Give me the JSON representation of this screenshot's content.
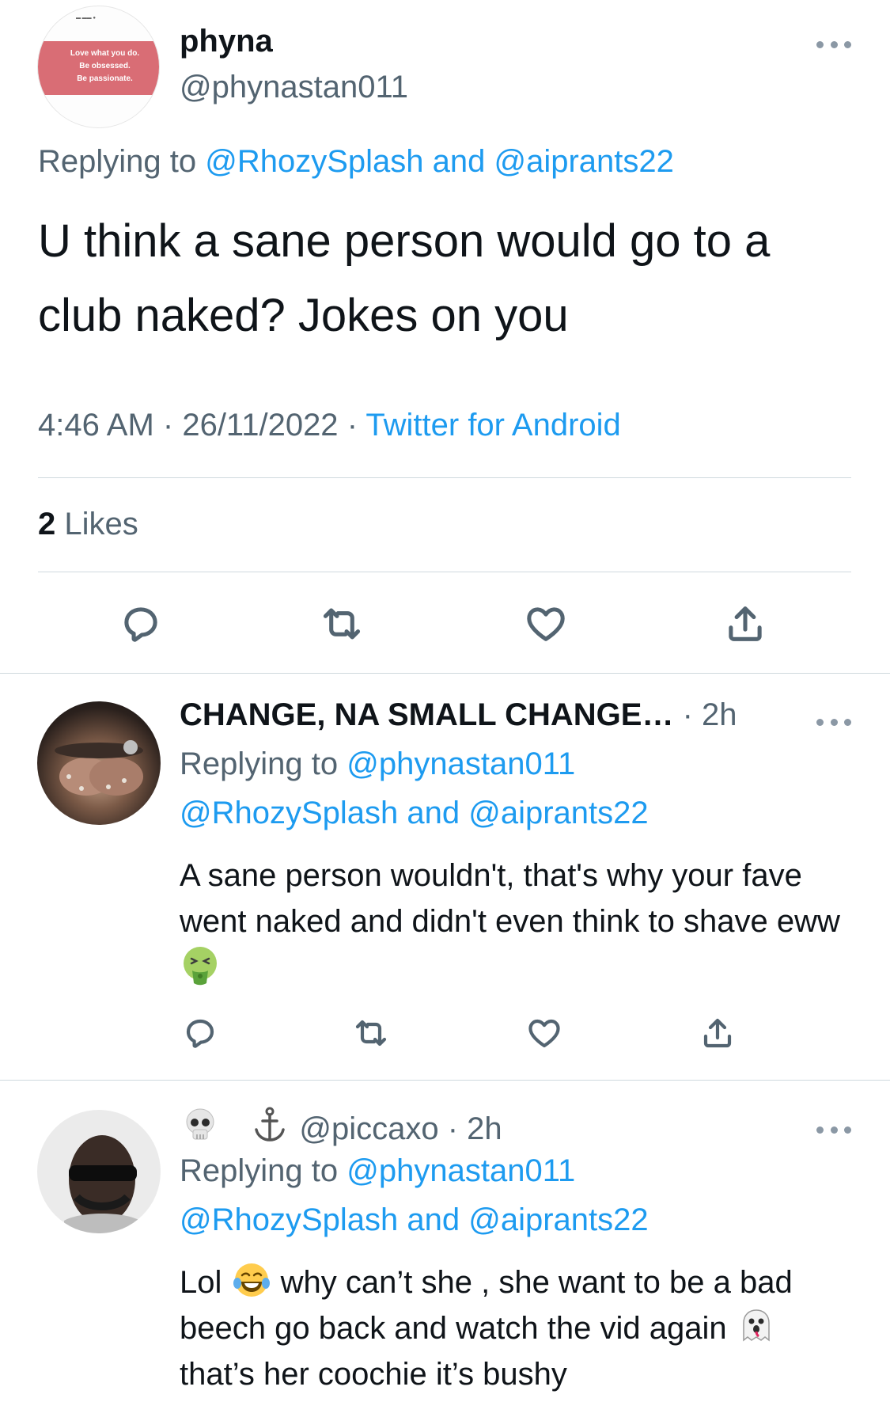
{
  "main_tweet": {
    "avatar_text": [
      "Love what you do.",
      "Be obsessed.",
      "Be passionate."
    ],
    "display_name": "phyna",
    "handle": "@phynastan011",
    "replying_prefix": "Replying to",
    "replying_users": "@RhozySplash and @aiprants22",
    "text": "U think a sane person would go to a club naked? Jokes on you",
    "time": "4:46 AM",
    "date": "26/11/2022",
    "source": "Twitter for Android",
    "likes_count": "2",
    "likes_label": "Likes"
  },
  "replies": [
    {
      "display_name": "CHANGE, NA SMALL CHANGE…",
      "time": "2h",
      "replying_prefix": "Replying to",
      "replying_user": "@phynastan011",
      "replying_more": "@RhozySplash and @aiprants22",
      "text": "A sane person wouldn't, that's why your fave went naked and didn't even think to shave eww",
      "emoji": "nauseated-face"
    },
    {
      "name_emojis": [
        "skull",
        "anchor"
      ],
      "handle": "@piccaxo",
      "time": "2h",
      "replying_prefix": "Replying to",
      "replying_user": "@phynastan011",
      "replying_more": "@RhozySplash and @aiprants22",
      "text_1": "Lol",
      "text_2": "why can’t she , she want to be a bad beech go back and watch the vid again",
      "text_3": "that’s her coochie it’s bushy",
      "emoji_1": "tears-of-joy",
      "emoji_2": "ghost"
    }
  ],
  "icons": [
    "more-icon",
    "reply-icon",
    "retweet-icon",
    "like-icon",
    "share-icon"
  ],
  "colors": {
    "link": "#1d9bf0",
    "secondary": "#536471",
    "text": "#0f1419",
    "divider": "#cfd9de"
  }
}
